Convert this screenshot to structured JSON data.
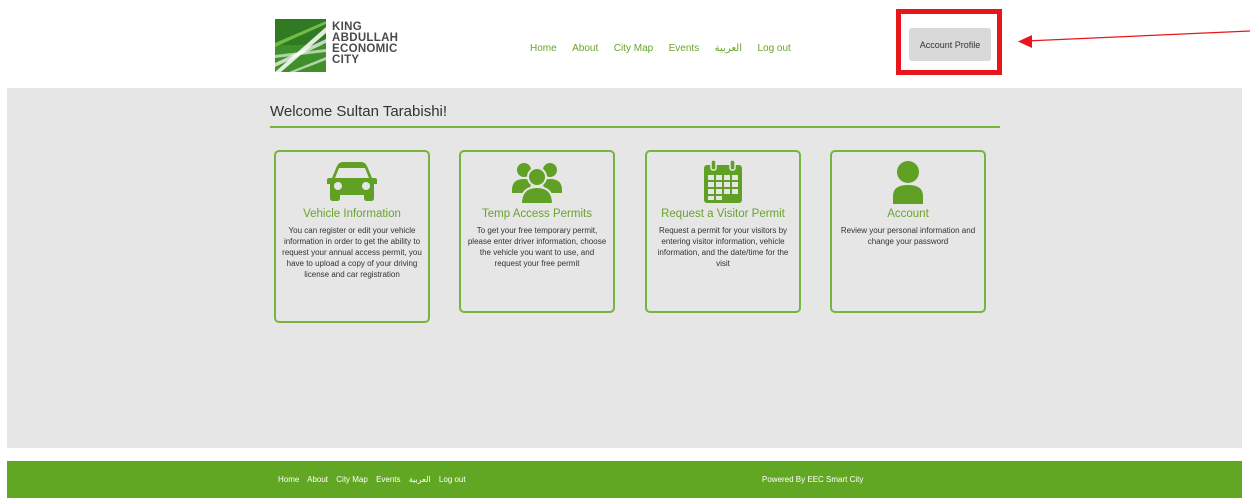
{
  "logo": {
    "lines": [
      "KING",
      "ABDULLAH",
      "ECONOMIC",
      "CITY"
    ]
  },
  "nav": {
    "items": [
      "Home",
      "About",
      "City Map",
      "Events",
      "العربية",
      "Log out"
    ]
  },
  "account_button": {
    "label": "Account Profile"
  },
  "annotation": {
    "highlight_color": "#e8161b"
  },
  "main": {
    "welcome": "Welcome Sultan Tarabishi!",
    "cards": [
      {
        "title": "Vehicle Information",
        "icon": "car-icon",
        "desc": "You can register or edit your vehicle information in order to get the ability to request your annual access permit, you have to upload a copy of your driving license and car registration"
      },
      {
        "title": "Temp Access Permits",
        "icon": "group-icon",
        "desc": "To get your free temporary permit, please enter driver information, choose the vehicle you want to use, and request your free permit"
      },
      {
        "title": "Request a Visitor Permit",
        "icon": "calendar-icon",
        "desc": "Request a permit for your visitors by entering visitor information, vehicle information, and the date/time for the visit"
      },
      {
        "title": "Account",
        "icon": "user-icon",
        "desc": "Review your personal information and change your password"
      }
    ]
  },
  "footer": {
    "nav": [
      "Home",
      "About",
      "City Map",
      "Events",
      "العربية",
      "Log out"
    ],
    "powered": "Powered By EEC Smart City"
  },
  "colors": {
    "accent": "#6aa32c",
    "footer_bg": "#62a724",
    "main_bg": "#e6e6e6"
  }
}
